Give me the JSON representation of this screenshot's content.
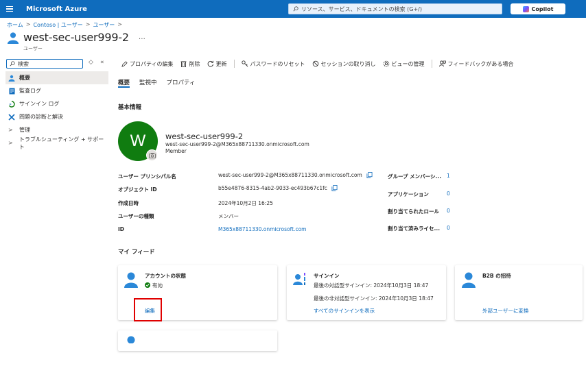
{
  "topbar": {
    "brand": "Microsoft Azure",
    "search_placeholder": "リソース、サービス、ドキュメントの検索 (G+/)",
    "copilot_label": "Copilot",
    "color": "#0f6cbd"
  },
  "breadcrumb": [
    "ホーム",
    "Contoso | ユーザー",
    "ユーザー"
  ],
  "page": {
    "title": "west-sec-user999-2",
    "subtitle": "ユーザー",
    "ellipsis": "…"
  },
  "nav": {
    "search_value": "検索",
    "items": [
      {
        "label": "概要",
        "icon": "user-icon",
        "active": true
      },
      {
        "label": "監査ログ",
        "icon": "audit-log-icon",
        "active": false
      },
      {
        "label": "サインイン ログ",
        "icon": "sign-in-icon",
        "active": false
      },
      {
        "label": "問題の診断と解決",
        "icon": "wrench-icon",
        "active": false
      },
      {
        "label": "管理",
        "icon": "chevron-right-icon",
        "active": false
      },
      {
        "label": "トラブルシューティング + サポート",
        "icon": "chevron-right-icon",
        "active": false
      }
    ]
  },
  "toolbar": {
    "edit_properties": "プロパティの編集",
    "delete": "削除",
    "refresh": "更新",
    "reset_password": "パスワードのリセット",
    "revoke_sessions": "セッションの取り消し",
    "manage_view": "ビューの管理",
    "feedback": "フィードバックがある場合"
  },
  "tabs": [
    "概要",
    "監視中",
    "プロパティ"
  ],
  "basic_info": {
    "heading": "基本情報",
    "avatar_initial": "W",
    "avatar_color": "#107c10",
    "name": "west-sec-user999-2",
    "email": "west-sec-user999-2@M365x88711330.onmicrosoft.com",
    "role": "Member"
  },
  "properties": [
    {
      "label": "ユーザー プリンシパル名",
      "value": "west-sec-user999-2@M365x88711330.onmicrosoft.com",
      "copy": true,
      "link": false
    },
    {
      "label": "オブジェクト ID",
      "value": "b55e4876-8315-4ab2-9033-ec493b67c1fc",
      "copy": true,
      "link": false
    },
    {
      "label": "作成日時",
      "value": "2024年10月2日 16:25",
      "copy": false,
      "link": false
    },
    {
      "label": "ユーザーの種類",
      "value": "メンバー",
      "copy": false,
      "link": false
    },
    {
      "label": "ID",
      "value": "M365x88711330.onmicrosoft.com",
      "copy": false,
      "link": true
    }
  ],
  "stats": [
    {
      "label": "グループ メンバーシ...",
      "value": "1"
    },
    {
      "label": "アプリケーション",
      "value": "0"
    },
    {
      "label": "割り当てられたロール",
      "value": "0"
    },
    {
      "label": "割り当て済みライセ...",
      "value": "0"
    }
  ],
  "feed": {
    "heading": "マイ フィード",
    "account": {
      "title": "アカウントの状態",
      "status": "有効",
      "edit_link": "編集"
    },
    "signin": {
      "title": "サインイン",
      "last_interactive": "最後の対話型サインイン: 2024年10月3日 18:47",
      "last_noninteractive": "最後の非対話型サインイン: 2024年10月3日 18:47",
      "view_all": "すべてのサインインを表示"
    },
    "b2b": {
      "title": "B2B の招待",
      "convert_link": "外部ユーザーに変換"
    }
  }
}
